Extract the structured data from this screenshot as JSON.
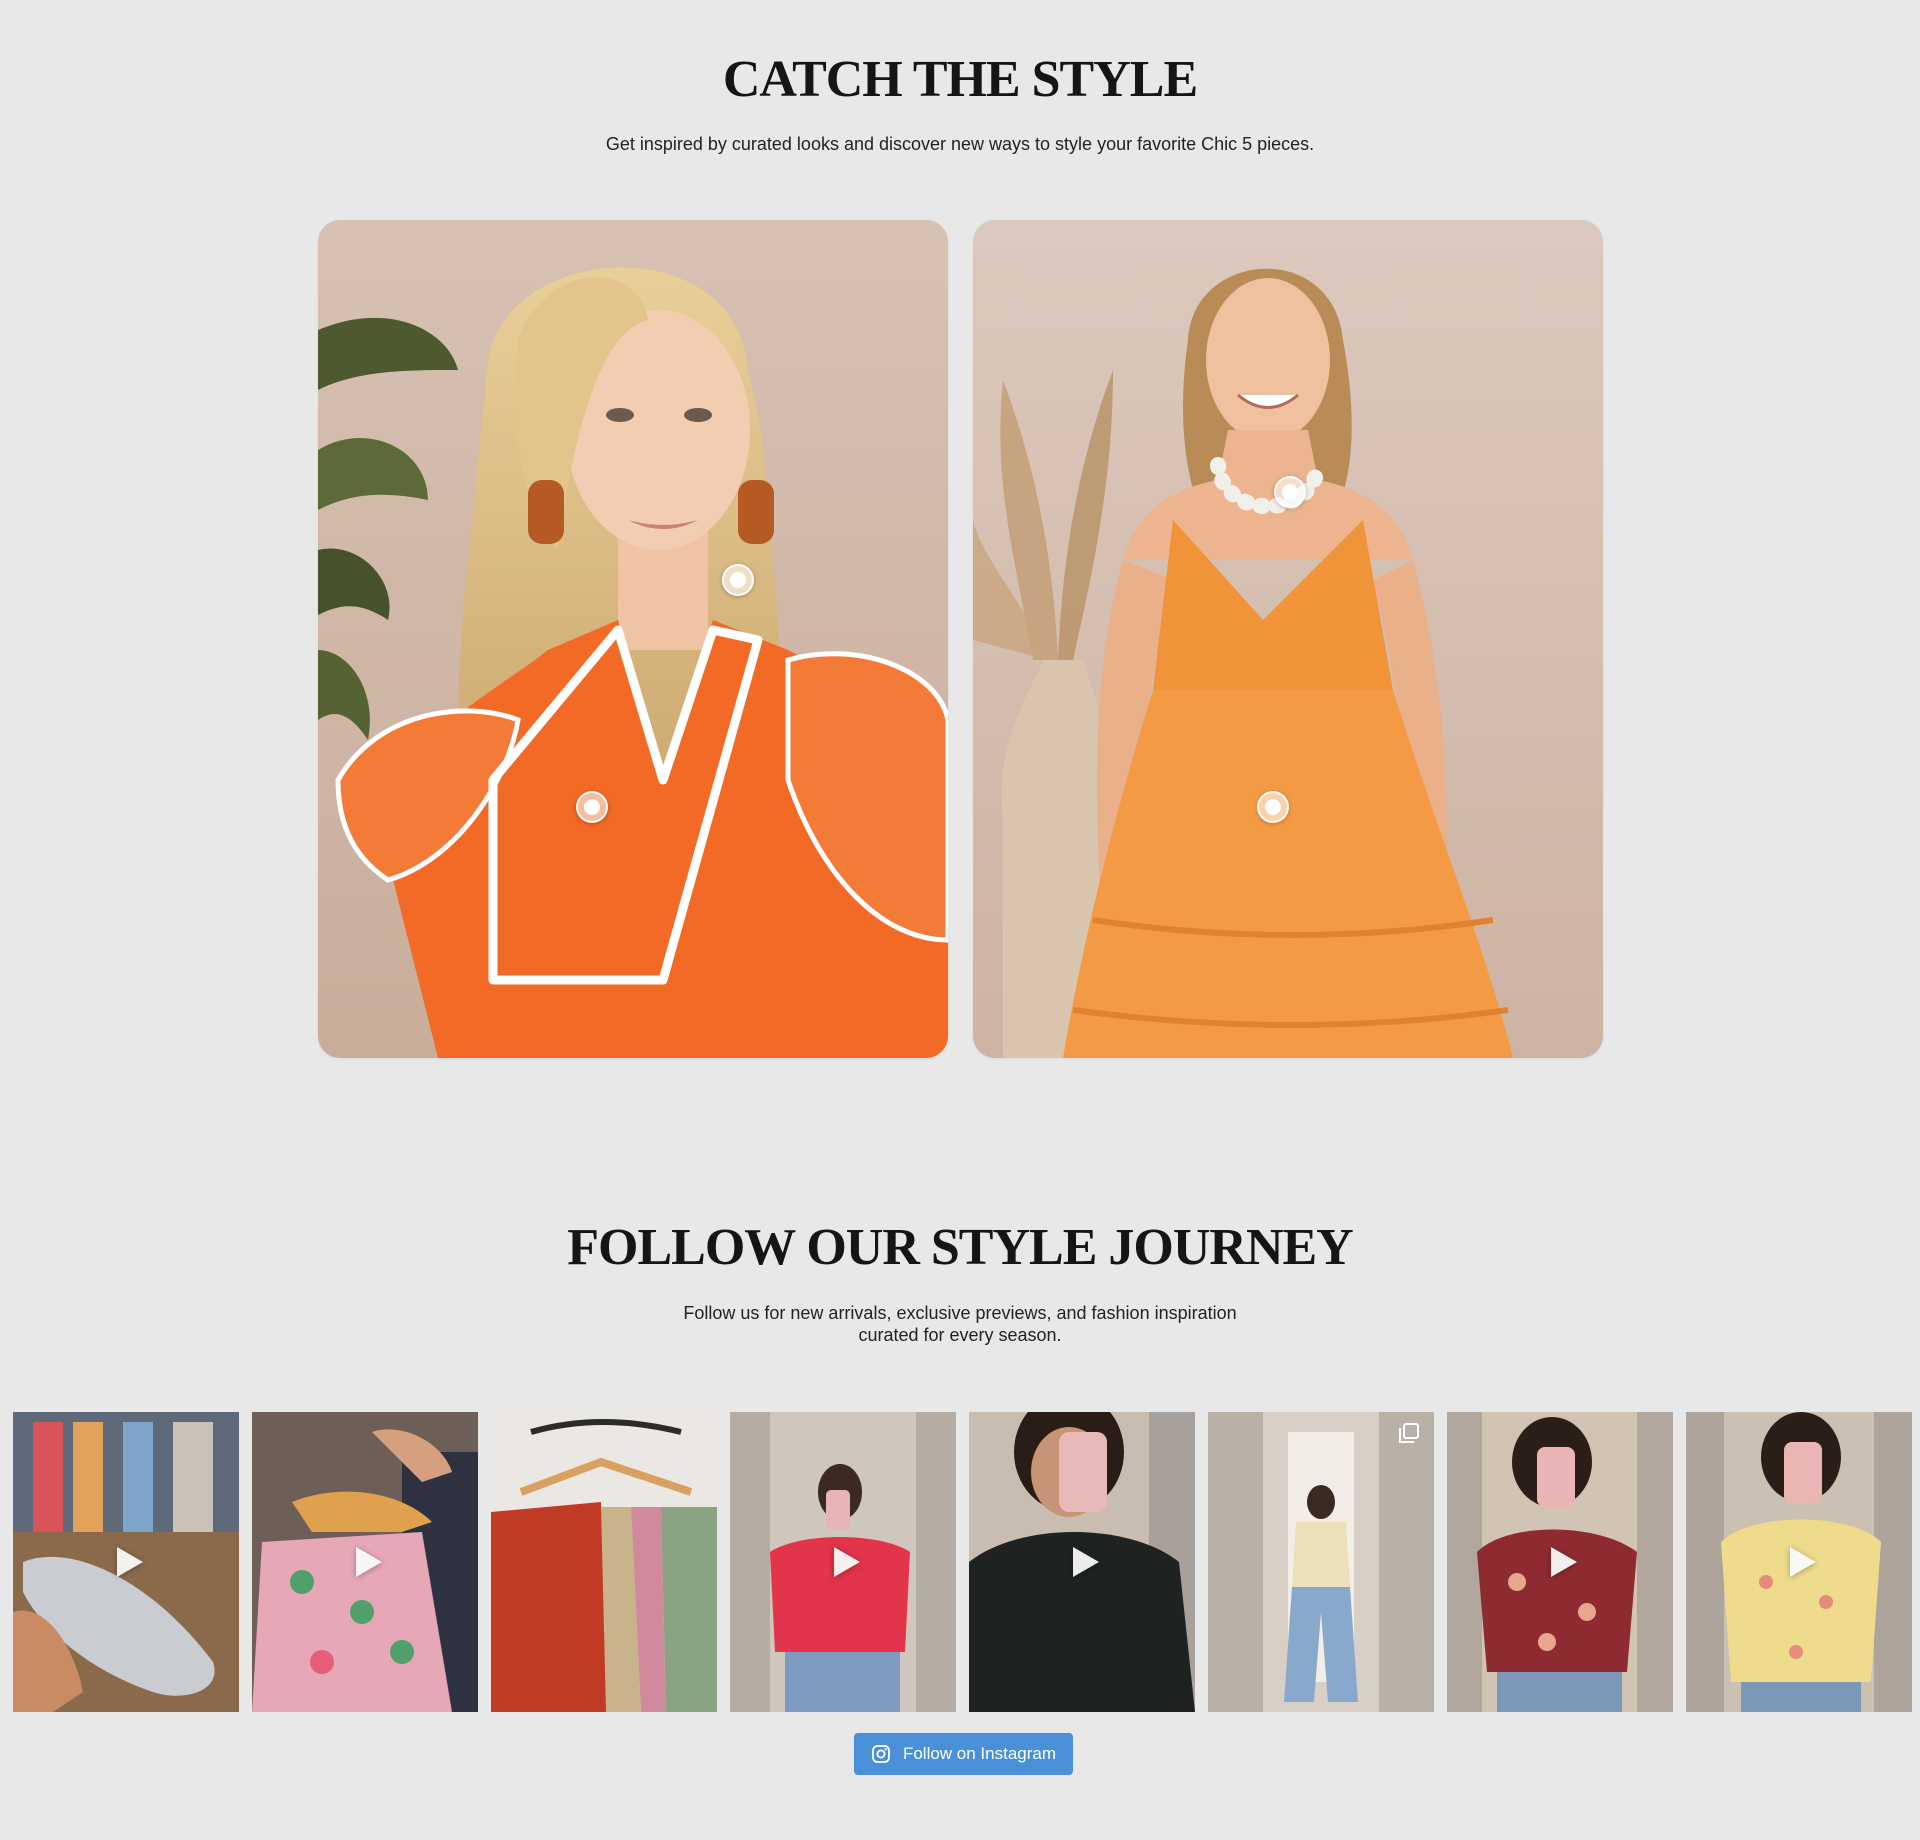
{
  "catch_section": {
    "title": "CATCH THE STYLE",
    "subtitle": "Get inspired by curated looks and discover new ways to style your favorite Chic 5 pieces."
  },
  "follow_section": {
    "title": "FOLLOW OUR STYLE JOURNEY",
    "subtitle": "Follow us for new arrivals, exclusive previews, and fashion inspiration curated for every season.",
    "button_label": "Follow on Instagram"
  },
  "colors": {
    "page_background": "#e8e8e8",
    "button_blue": "#4a90d9",
    "accent_orange": "#f26a25"
  },
  "icons": [
    "hotspot-icon",
    "play-icon",
    "carousel-icon",
    "instagram-icon"
  ]
}
